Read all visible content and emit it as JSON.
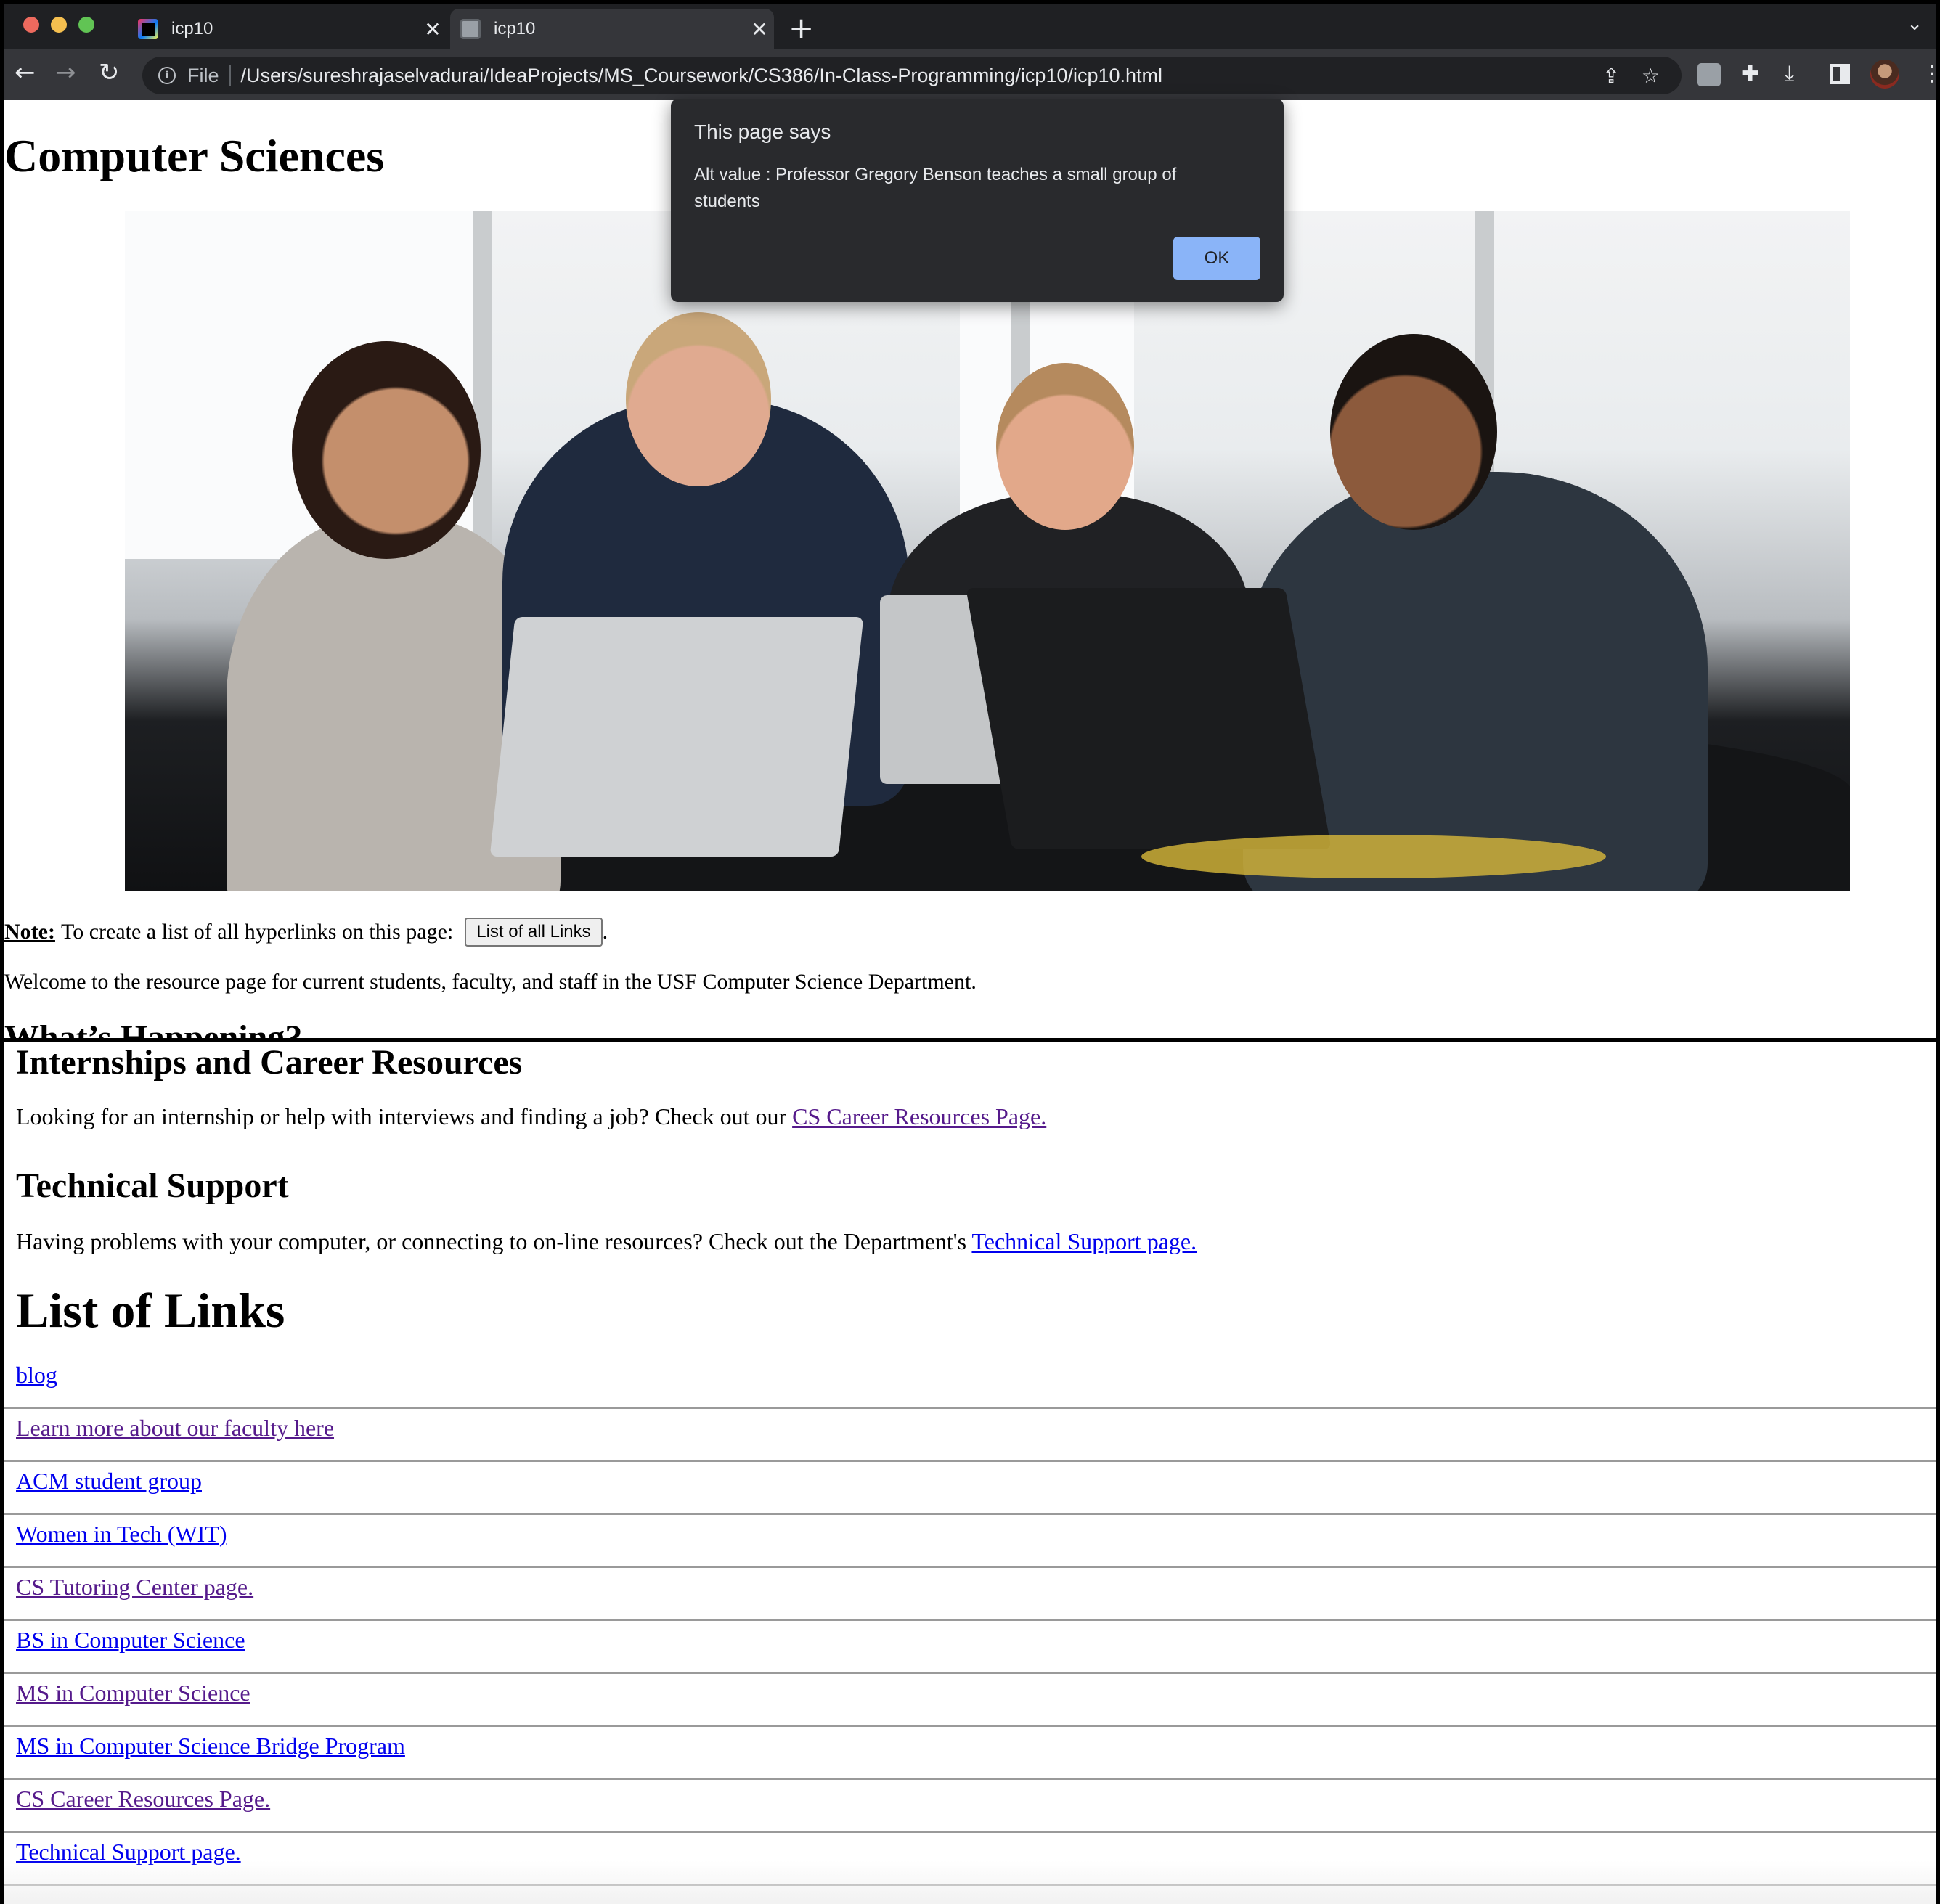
{
  "browser": {
    "tabs": [
      {
        "title": "icp10",
        "icon": "intellij-icon",
        "active": false
      },
      {
        "title": "icp10",
        "icon": "globe-icon",
        "active": true
      }
    ],
    "new_tab_symbol": "+",
    "tab_close_symbol": "✕",
    "tab_search_symbol": "⌄",
    "back_symbol": "←",
    "forward_symbol": "→",
    "reload_symbol": "↻",
    "scheme_label": "File",
    "url": "/Users/sureshrajaselvadurai/IdeaProjects/MS_Coursework/CS386/In-Class-Programming/icp10/icp10.html",
    "share_symbol": "⇪",
    "bookmark_symbol": "☆",
    "puzzle_symbol": "✚",
    "download_symbol": "⤓",
    "menu_symbol": "⋮"
  },
  "dialog": {
    "title": "This page says",
    "message": "Alt value : Professor Gregory Benson teaches a small group of students",
    "ok_label": "OK"
  },
  "page_top": {
    "title": "Computer Sciences",
    "note_label": "Note:",
    "note_text": "To create a list of all hyperlinks on this page:",
    "button_label": "List of all Links",
    "note_end": ".",
    "welcome": "Welcome to the resource page for current students, faculty, and staff in the USF Computer Science Department.",
    "whats_happening": "What’s Happening?"
  },
  "page_bottom": {
    "internships_heading": "Internships and Career Resources",
    "internships_text": "Looking for an internship or help with interviews and finding a job? Check out our ",
    "internships_link": "CS Career Resources Page.",
    "support_heading": "Technical Support",
    "support_text": "Having problems with your computer, or connecting to on-line resources? Check out the Department's ",
    "support_link": "Technical Support page.",
    "links_heading": "List of Links",
    "links": [
      {
        "label": "blog",
        "visited": false
      },
      {
        "label": "Learn more about our faculty here",
        "visited": true
      },
      {
        "label": "ACM student group",
        "visited": false
      },
      {
        "label": "Women in Tech (WIT)",
        "visited": false
      },
      {
        "label": "CS Tutoring Center page.",
        "visited": true
      },
      {
        "label": "BS in Computer Science",
        "visited": false
      },
      {
        "label": "MS in Computer Science",
        "visited": true
      },
      {
        "label": "MS in Computer Science Bridge Program",
        "visited": false
      },
      {
        "label": "CS Career Resources Page.",
        "visited": true
      },
      {
        "label": "Technical Support page.",
        "visited": false
      }
    ]
  },
  "colors": {
    "link": "#0000ee",
    "visited_link": "#551a8b",
    "dialog_bg": "#292a2d",
    "ok_button": "#8ab4f8"
  }
}
